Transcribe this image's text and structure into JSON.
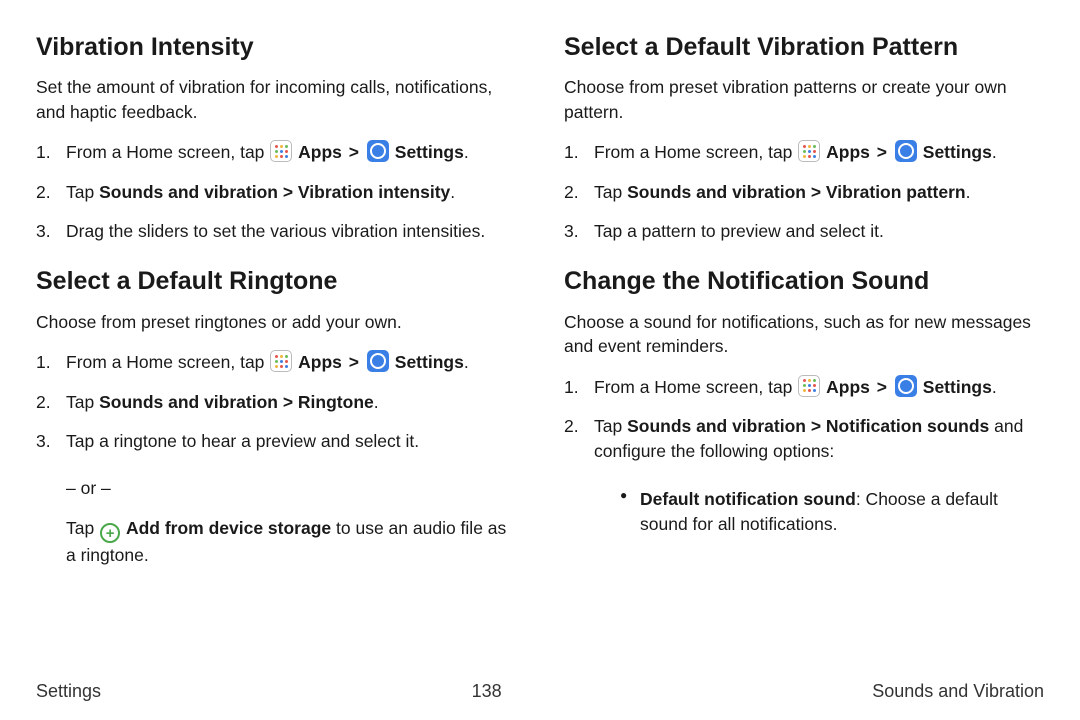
{
  "left": {
    "section1": {
      "heading": "Vibration Intensity",
      "intro": "Set the amount of vibration for incoming calls, notifications, and haptic feedback.",
      "step1_pre": "From a Home screen, tap ",
      "apps": "Apps",
      "caret": ">",
      "settings": "Settings",
      "step2_pre": "Tap ",
      "step2_bold": "Sounds and vibration > Vibration intensity",
      "step3": "Drag the sliders to set the various vibration intensities."
    },
    "section2": {
      "heading": "Select a Default Ringtone",
      "intro": "Choose from preset ringtones or add your own.",
      "step1_pre": "From a Home screen, tap ",
      "apps": "Apps",
      "caret": ">",
      "settings": "Settings",
      "step2_pre": "Tap ",
      "step2_bold": "Sounds and vibration > Ringtone",
      "step3": "Tap a ringtone to hear a preview and select it.",
      "or": "– or –",
      "sub_pre": "Tap ",
      "add_label": "Add from device storage",
      "sub_post": " to use an audio file as a ringtone."
    }
  },
  "right": {
    "section1": {
      "heading": "Select a Default Vibration Pattern",
      "intro": "Choose from preset vibration patterns or create your own pattern.",
      "step1_pre": "From a Home screen, tap ",
      "apps": "Apps",
      "caret": ">",
      "settings": "Settings",
      "step2_pre": "Tap ",
      "step2_bold": "Sounds and vibration > Vibration pattern",
      "step3": "Tap a pattern to preview and select it."
    },
    "section2": {
      "heading": "Change the Notification Sound",
      "intro": "Choose a sound for notifications, such as for new messages and event reminders.",
      "step1_pre": "From a Home screen, tap ",
      "apps": "Apps",
      "caret": ">",
      "settings": "Settings",
      "step2_pre": "Tap ",
      "step2_bold": "Sounds and vibration > Notification sounds",
      "step2_post": " and configure the following options:",
      "bullet_bold": "Default notification sound",
      "bullet_post": ": Choose a default sound for all notifications."
    }
  },
  "footer": {
    "left": "Settings",
    "center": "138",
    "right": "Sounds and Vibration"
  },
  "period": "."
}
